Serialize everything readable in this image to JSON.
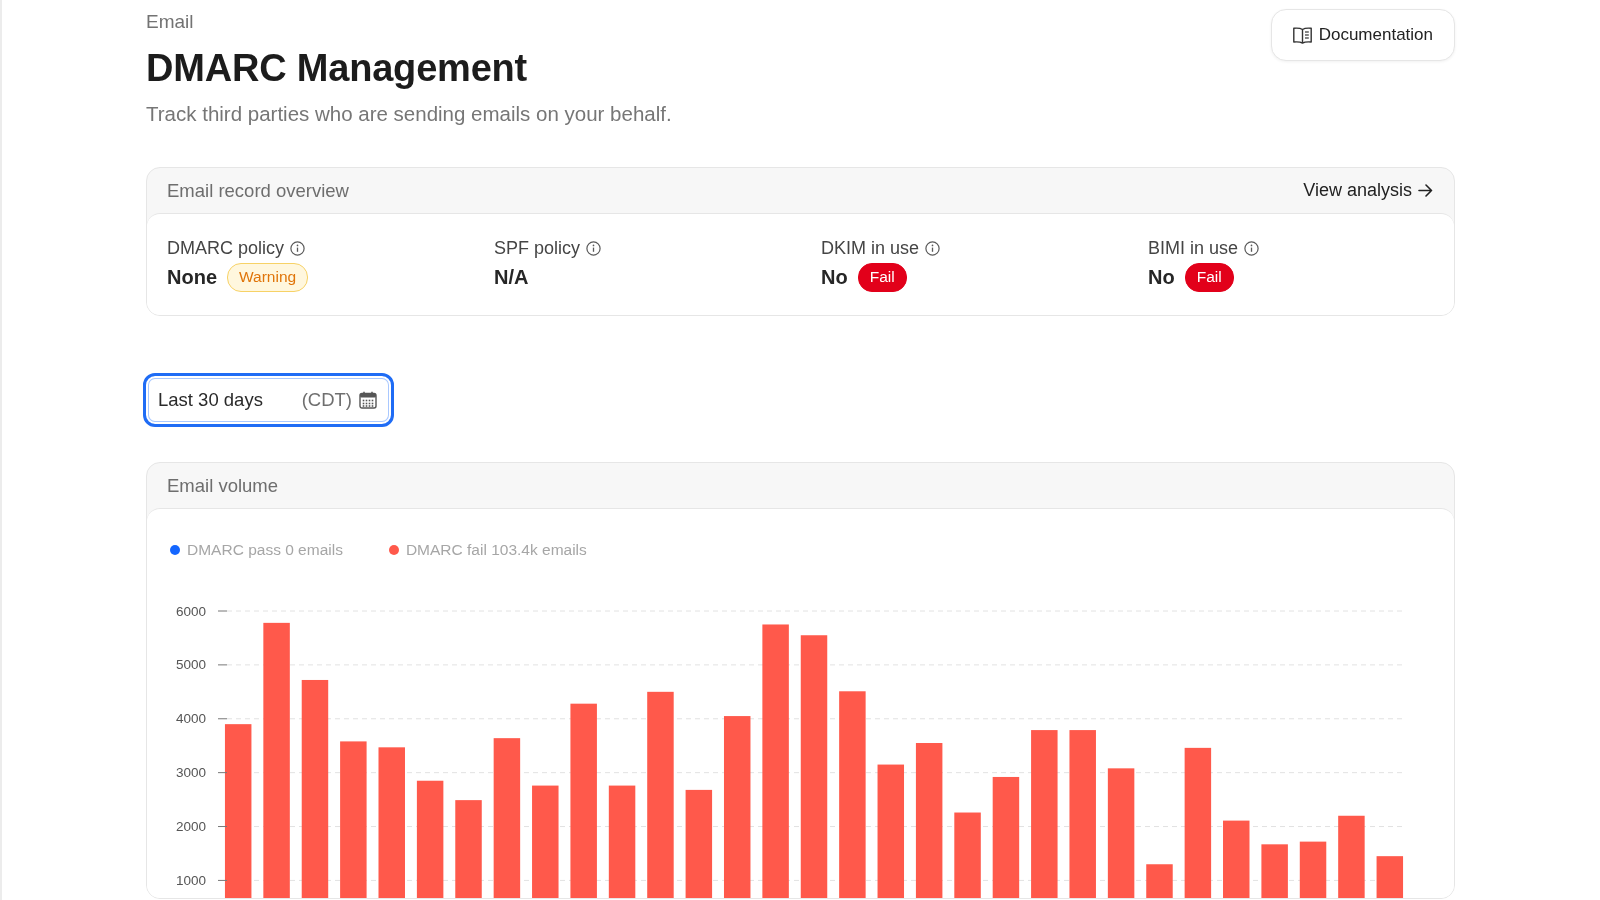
{
  "breadcrumb": "Email",
  "title": "DMARC Management",
  "subtitle": "Track third parties who are sending emails on your behalf.",
  "documentation_button": {
    "label": "Documentation"
  },
  "record_overview": {
    "title": "Email record overview",
    "link": "View analysis",
    "items": [
      {
        "label": "DMARC policy",
        "value": "None",
        "badge": {
          "text": "Warning",
          "kind": "warning"
        }
      },
      {
        "label": "SPF policy",
        "value": "N/A"
      },
      {
        "label": "DKIM in use",
        "value": "No",
        "badge": {
          "text": "Fail",
          "kind": "fail"
        }
      },
      {
        "label": "BIMI in use",
        "value": "No",
        "badge": {
          "text": "Fail",
          "kind": "fail"
        }
      }
    ]
  },
  "date_range": {
    "value": "Last 30 days",
    "timezone": "(CDT)",
    "focused": true
  },
  "email_volume": {
    "title": "Email volume",
    "legend": [
      {
        "label": "DMARC pass 0 emails",
        "color": "#1466ff"
      },
      {
        "label": "DMARC fail 103.4k emails",
        "color": "#ff594b"
      }
    ],
    "chart_data": {
      "type": "bar",
      "grid": true,
      "ylim": [
        0,
        6000
      ],
      "yticks": [
        1000,
        2000,
        3000,
        4000,
        5000,
        6000
      ],
      "series": [
        {
          "color": "#ff594b",
          "values": [
            3900,
            5780,
            4720,
            3580,
            3470,
            2850,
            2490,
            3640,
            2760,
            4280,
            2760,
            4500,
            2680,
            4050,
            5750,
            5550,
            4510,
            3150,
            3550,
            2260,
            2920,
            3790,
            3790,
            3080,
            1300,
            3460,
            2110,
            1670,
            1720,
            2200,
            1450
          ]
        }
      ]
    }
  }
}
